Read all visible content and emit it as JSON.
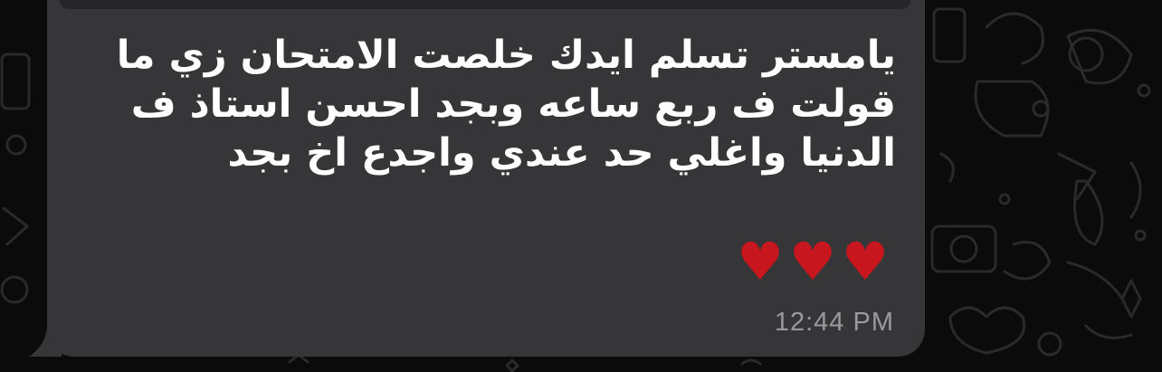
{
  "message": {
    "lines": [
      "يامستر تسلم ايدك خلصت الامتحان زي ما",
      "قولت ف ربع ساعه وبجد احسن استاذ ف",
      "الدنيا واغلي حد عندي واجدع اخ بجد"
    ],
    "emoji": "♥♥♥",
    "timestamp": "12:44 PM"
  },
  "colors": {
    "background": "#0b0b0b",
    "bubble": "#363638",
    "text": "#ffffff",
    "heart": "#c8161e",
    "timestamp": "#9a9a9e"
  },
  "icons": {
    "wallpaper_doodles": [
      "phone-icon",
      "teapot-icon",
      "slipper-icon",
      "camera-icon",
      "star-icon",
      "cloud-icon"
    ]
  }
}
